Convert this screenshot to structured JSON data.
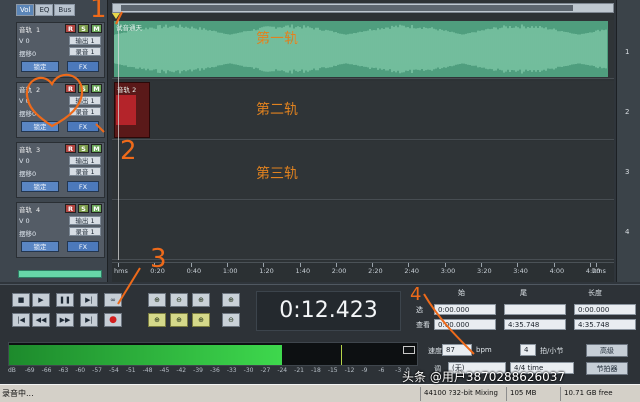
{
  "tabs": [
    "Vol",
    "EQ",
    "Bus"
  ],
  "tracks": [
    {
      "name": "音轨",
      "num": "1",
      "vol": "V 0",
      "pan": "摆移0",
      "out": "输出 1",
      "in": "录音 1",
      "lock": "锁定",
      "fx": "FX",
      "lane_label": "第一轨",
      "lane_num": "1"
    },
    {
      "name": "音轨",
      "num": "2",
      "vol": "V 0",
      "pan": "摆移0",
      "out": "输出 1",
      "in": "录音 1",
      "lock": "锁定",
      "fx": "FX",
      "lane_label": "第二轨",
      "lane_num": "2"
    },
    {
      "name": "音轨",
      "num": "3",
      "vol": "V 0",
      "pan": "摆移0",
      "out": "输出 1",
      "in": "录音 1",
      "lock": "锁定",
      "fx": "FX",
      "lane_label": "第三轨",
      "lane_num": "3"
    },
    {
      "name": "音轨",
      "num": "4",
      "vol": "V 0",
      "pan": "摆移0",
      "out": "输出 1",
      "in": "录音 1",
      "lock": "锁定",
      "fx": "FX",
      "lane_label": "",
      "lane_num": "4"
    }
  ],
  "track_buttons": {
    "record": "R",
    "solo": "S",
    "mute": "M"
  },
  "clip1_name": "试音通天",
  "clip2_name": "音轨 2",
  "ruler_labels": [
    "hms",
    "0:20",
    "0:40",
    "1:00",
    "1:20",
    "1:40",
    "2:00",
    "2:20",
    "2:40",
    "3:00",
    "3:20",
    "3:40",
    "4:00",
    "4:20",
    "hms"
  ],
  "transport": {
    "row1": [
      "■",
      "▶",
      "❚❚",
      "▶|",
      "∞"
    ],
    "row2": [
      "|◀",
      "◀◀",
      "▶▶",
      "▶|",
      "●"
    ]
  },
  "zoom": {
    "row1": [
      "⊕",
      "⊖",
      "⊕",
      "⊕"
    ],
    "row2": [
      "⊕",
      "⊕",
      "⊕",
      "⊖"
    ]
  },
  "time_display": "0:12.423",
  "selection": {
    "headers": [
      "始",
      "尾",
      "长度"
    ],
    "rows": [
      {
        "label": "选",
        "start": "0:00.000",
        "end": "",
        "length": "0:00.000"
      },
      {
        "label": "查看",
        "start": "0:00.000",
        "end": "4:35.748",
        "length": "4:35.748"
      }
    ]
  },
  "meter": {
    "level": 0.667,
    "db_labels": [
      "dB",
      "-69",
      "-66",
      "-63",
      "-60",
      "-57",
      "-54",
      "-51",
      "-48",
      "-45",
      "-42",
      "-39",
      "-36",
      "-33",
      "-30",
      "-27",
      "-24",
      "-21",
      "-18",
      "-15",
      "-12",
      "-9",
      "-6",
      "-3",
      "0"
    ]
  },
  "tempo": {
    "label": "速度",
    "value": "87",
    "unit": "bpm",
    "beats": "4",
    "beats_unit": "拍/小节",
    "advanced": "高级",
    "key_label": "调",
    "key_value": "(无)",
    "time_sig": "4/4 time",
    "metronome": "节拍器"
  },
  "status": {
    "text": "录音中...",
    "cells": [
      "44100 ?32-bit Mixing",
      "105 MB",
      "10.71 GB free"
    ]
  },
  "watermark": "头条 @用户3870288626037",
  "annotations": [
    "1",
    "2",
    "3",
    "4"
  ]
}
